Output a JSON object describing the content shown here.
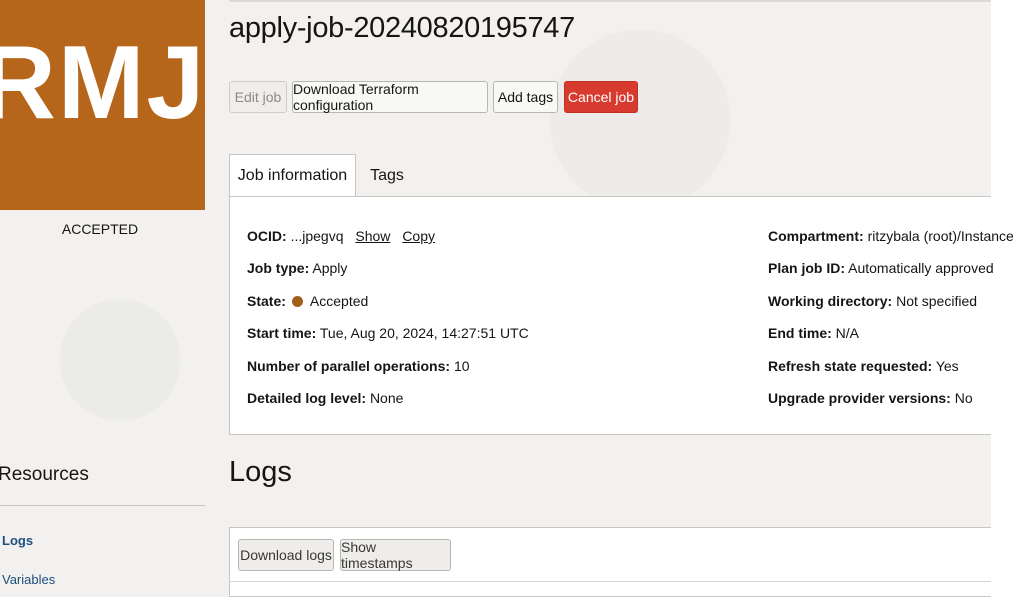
{
  "badge": {
    "text": "RMJ",
    "color": "#b5661b"
  },
  "state_label": "ACCEPTED",
  "resources": {
    "title": "Resources",
    "items": [
      {
        "label": "Logs",
        "active": true
      },
      {
        "label": "Variables",
        "active": false
      }
    ]
  },
  "job": {
    "title": "apply-job-20240820195747"
  },
  "actions": {
    "edit": "Edit job",
    "download_tf": "Download Terraform configuration",
    "add_tags": "Add tags",
    "cancel": "Cancel job"
  },
  "tabs": [
    {
      "label": "Job information",
      "active": true
    },
    {
      "label": "Tags",
      "active": false
    }
  ],
  "info": {
    "ocid": {
      "label": "OCID:",
      "value": "...jpegvq",
      "show": "Show",
      "copy": "Copy"
    },
    "job_type": {
      "label": "Job type:",
      "value": "Apply"
    },
    "state": {
      "label": "State:",
      "value": "Accepted",
      "color": "#a15f1a"
    },
    "start_time": {
      "label": "Start time:",
      "value": "Tue, Aug 20, 2024, 14:27:51 UTC"
    },
    "parallel": {
      "label": "Number of parallel operations:",
      "value": "10"
    },
    "log_level": {
      "label": "Detailed log level:",
      "value": "None"
    },
    "compartment": {
      "label": "Compartment:",
      "value": "ritzybala (root)/Instance"
    },
    "plan_job": {
      "label": "Plan job ID:",
      "value": "Automatically approved"
    },
    "working_dir": {
      "label": "Working directory:",
      "value": "Not specified"
    },
    "end_time": {
      "label": "End time:",
      "value": "N/A"
    },
    "refresh": {
      "label": "Refresh state requested:",
      "value": "Yes"
    },
    "upgrade": {
      "label": "Upgrade provider versions:",
      "value": "No"
    }
  },
  "logs": {
    "title": "Logs",
    "download": "Download logs",
    "timestamps": "Show timestamps"
  }
}
